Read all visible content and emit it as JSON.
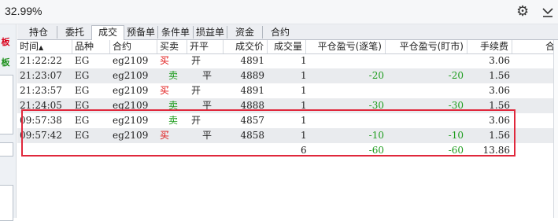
{
  "top": {
    "percent": "32.99%"
  },
  "left_panel": {
    "label1": "板",
    "label2": "板"
  },
  "tabs": [
    "持仓",
    "委托",
    "成交",
    "预备单",
    "条件单",
    "损益单",
    "资金",
    "合约"
  ],
  "active_tab": "成交",
  "columns": {
    "time": "时间",
    "sort_indicator": "▲",
    "variety": "品种",
    "contract": "合约",
    "side": "买卖",
    "openclose": "开平",
    "price": "成交价",
    "qty": "成交量",
    "pnl_trade": "平仓盈亏(逐笔)",
    "pnl_mark": "平仓盈亏(盯市)",
    "fee": "手续费",
    "extra": "合"
  },
  "rows": [
    {
      "time": "21:22:22",
      "variety": "EG",
      "contract": "eg2109",
      "side": "买",
      "side_type": "buy",
      "openclose": "开",
      "price": "4891",
      "qty": "1",
      "pnl_trade": "",
      "pnl_mark": "",
      "fee": "3.06"
    },
    {
      "time": "21:23:07",
      "variety": "EG",
      "contract": "eg2109",
      "side": "卖",
      "side_type": "sell",
      "openclose": "平",
      "price": "4889",
      "qty": "1",
      "pnl_trade": "-20",
      "pnl_mark": "-20",
      "fee": "1.56"
    },
    {
      "time": "21:23:57",
      "variety": "EG",
      "contract": "eg2109",
      "side": "买",
      "side_type": "buy",
      "openclose": "开",
      "price": "4891",
      "qty": "1",
      "pnl_trade": "",
      "pnl_mark": "",
      "fee": "3.06"
    },
    {
      "time": "21:24:05",
      "variety": "EG",
      "contract": "eg2109",
      "side": "卖",
      "side_type": "sell",
      "openclose": "平",
      "price": "4888",
      "qty": "1",
      "pnl_trade": "-30",
      "pnl_mark": "-30",
      "fee": "1.56"
    },
    {
      "time": "09:57:38",
      "variety": "EG",
      "contract": "eg2109",
      "side": "卖",
      "side_type": "sell",
      "openclose": "开",
      "price": "4857",
      "qty": "1",
      "pnl_trade": "",
      "pnl_mark": "",
      "fee": "3.06"
    },
    {
      "time": "09:57:42",
      "variety": "EG",
      "contract": "eg2109",
      "side": "买",
      "side_type": "buy",
      "openclose": "平",
      "price": "4858",
      "qty": "1",
      "pnl_trade": "-10",
      "pnl_mark": "-10",
      "fee": "1.56"
    }
  ],
  "totals": {
    "qty": "6",
    "pnl_trade": "-60",
    "pnl_mark": "-60",
    "fee": "13.86"
  },
  "colors": {
    "buy": "#e01010",
    "sell": "#1c9c1c",
    "highlight_box": "#e0283c"
  }
}
